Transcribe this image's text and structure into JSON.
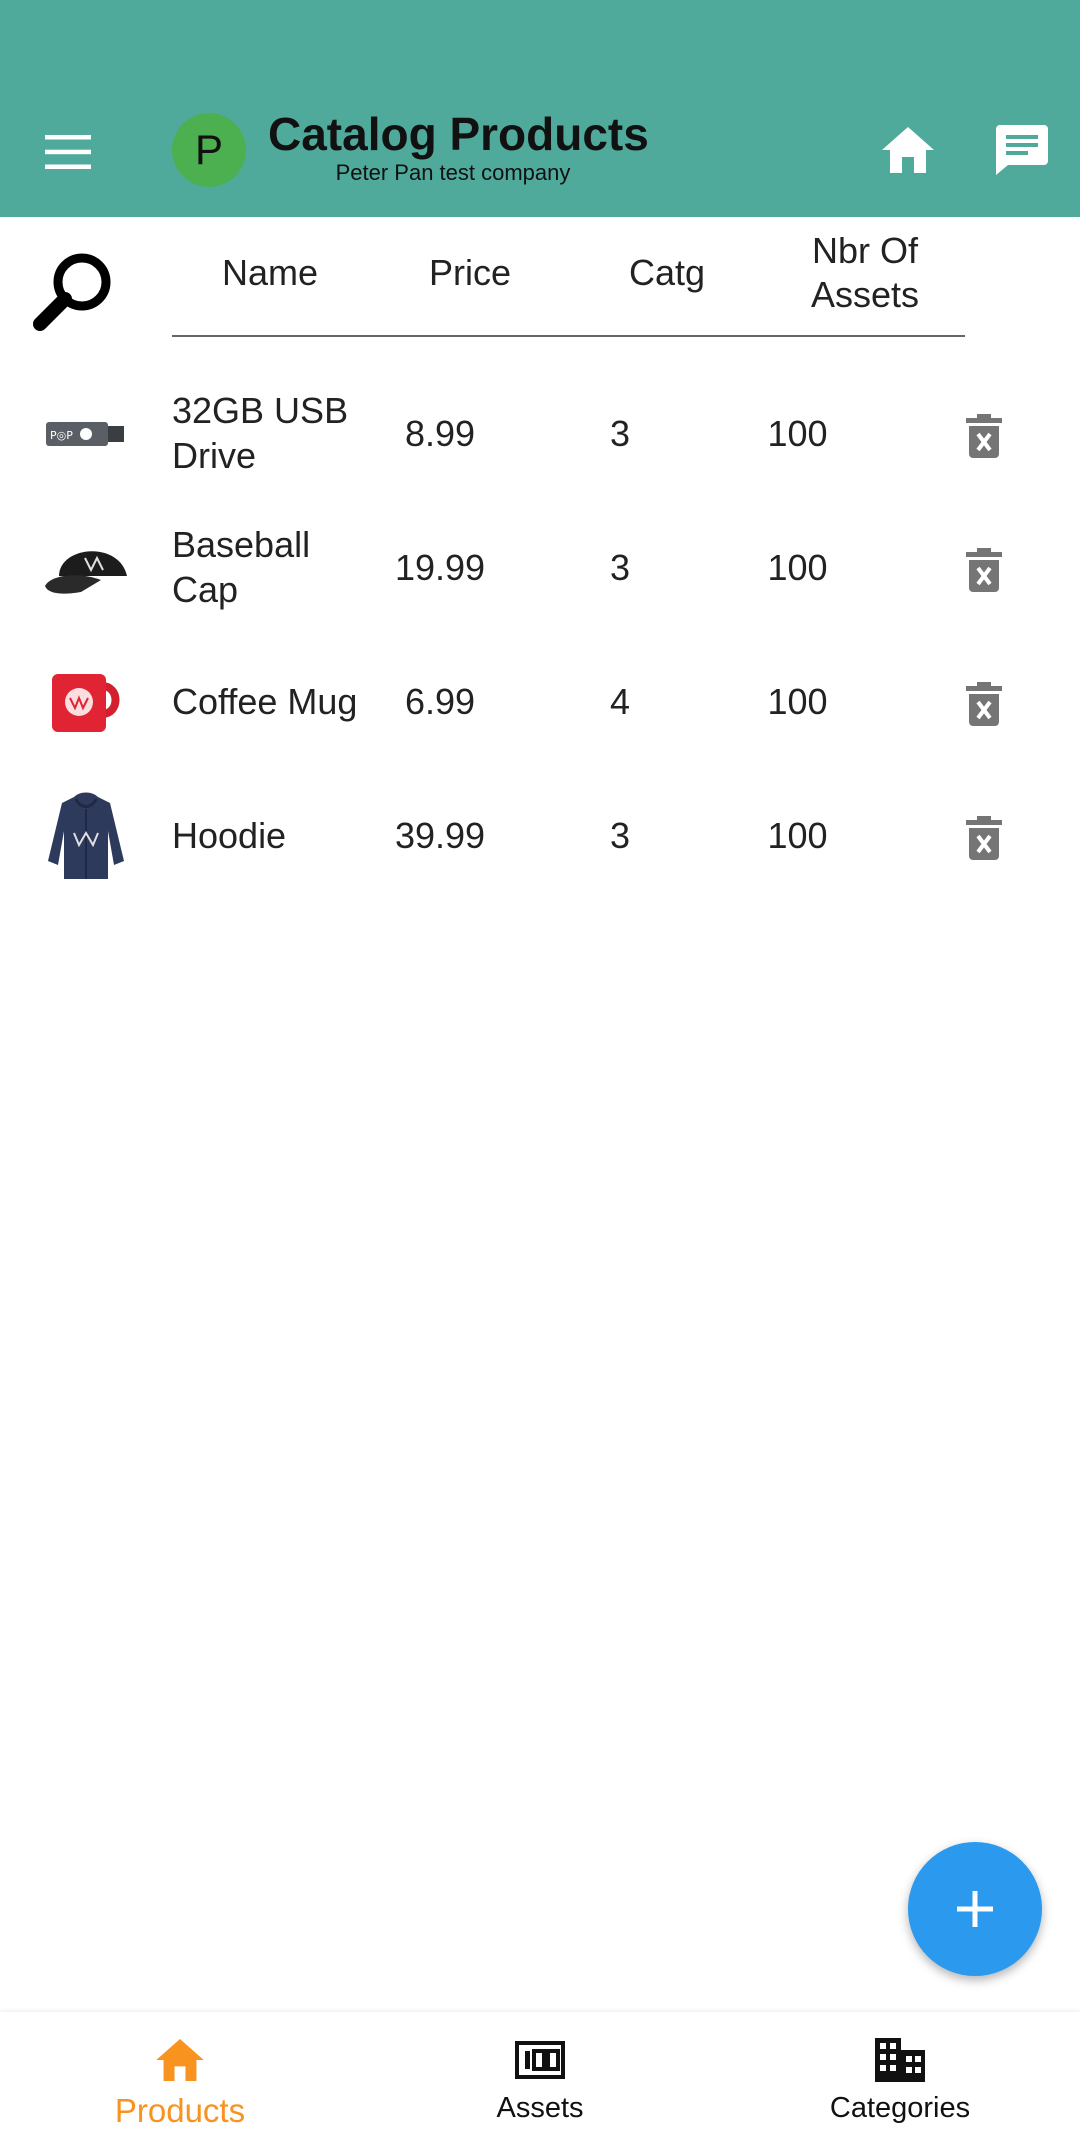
{
  "appbar": {
    "avatar_letter": "P",
    "title": "Catalog Products",
    "subtitle": "Peter Pan test company"
  },
  "table": {
    "headers": {
      "name": "Name",
      "price": "Price",
      "catg": "Catg",
      "assets_line1": "Nbr Of",
      "assets_line2": "Assets"
    },
    "rows": [
      {
        "thumb_icon": "usb-drive-icon",
        "name": "32GB USB Drive",
        "price": "8.99",
        "catg": "3",
        "assets": "100"
      },
      {
        "thumb_icon": "baseball-cap-icon",
        "name": "Baseball Cap",
        "price": "19.99",
        "catg": "3",
        "assets": "100"
      },
      {
        "thumb_icon": "coffee-mug-icon",
        "name": "Coffee Mug",
        "price": "6.99",
        "catg": "4",
        "assets": "100"
      },
      {
        "thumb_icon": "hoodie-icon",
        "name": "Hoodie",
        "price": "39.99",
        "catg": "3",
        "assets": "100"
      }
    ]
  },
  "bottom_nav": {
    "items": [
      {
        "label": "Products",
        "icon": "home-icon",
        "active": true
      },
      {
        "label": "Assets",
        "icon": "assets-icon",
        "active": false
      },
      {
        "label": "Categories",
        "icon": "building-icon",
        "active": false
      }
    ]
  },
  "colors": {
    "appbar": "#4faa9b",
    "fab": "#2b99ee",
    "active_nav": "#f7931e",
    "avatar": "#4caf50"
  }
}
